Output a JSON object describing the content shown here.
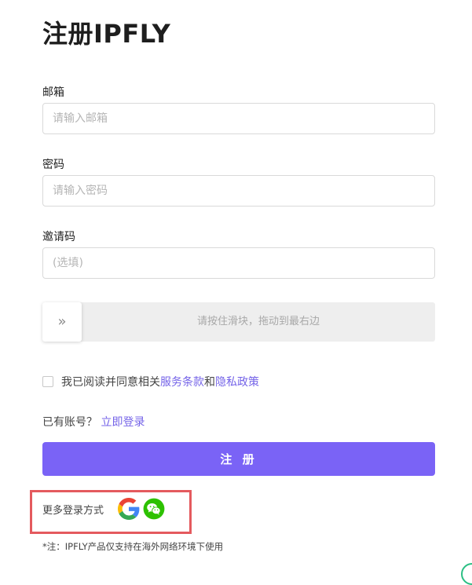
{
  "page": {
    "title": "注册IPFLY"
  },
  "form": {
    "email": {
      "label": "邮箱",
      "placeholder": "请输入邮箱",
      "value": ""
    },
    "password": {
      "label": "密码",
      "placeholder": "请输入密码",
      "value": ""
    },
    "invite": {
      "label": "邀请码",
      "placeholder": "(选填)",
      "value": ""
    }
  },
  "slider": {
    "handle_glyph": "»",
    "hint": "请按住滑块，拖动到最右边"
  },
  "agreement": {
    "prefix": "我已阅读并同意相关",
    "terms_link": "服务条款",
    "conjunction": "和",
    "privacy_link": "隐私政策",
    "checked": false
  },
  "account": {
    "question": "已有账号？",
    "login_link": "立即登录"
  },
  "submit": {
    "label": "注 册"
  },
  "more_login": {
    "label": "更多登录方式",
    "methods": [
      "google-icon",
      "wechat-icon"
    ]
  },
  "footnote": "*注：IPFLY产品仅支持在海外网络环境下使用",
  "colors": {
    "accent": "#7a63f6",
    "link": "#7463e8",
    "highlight_border": "#e45a5e",
    "wechat_green": "#2dc100"
  }
}
